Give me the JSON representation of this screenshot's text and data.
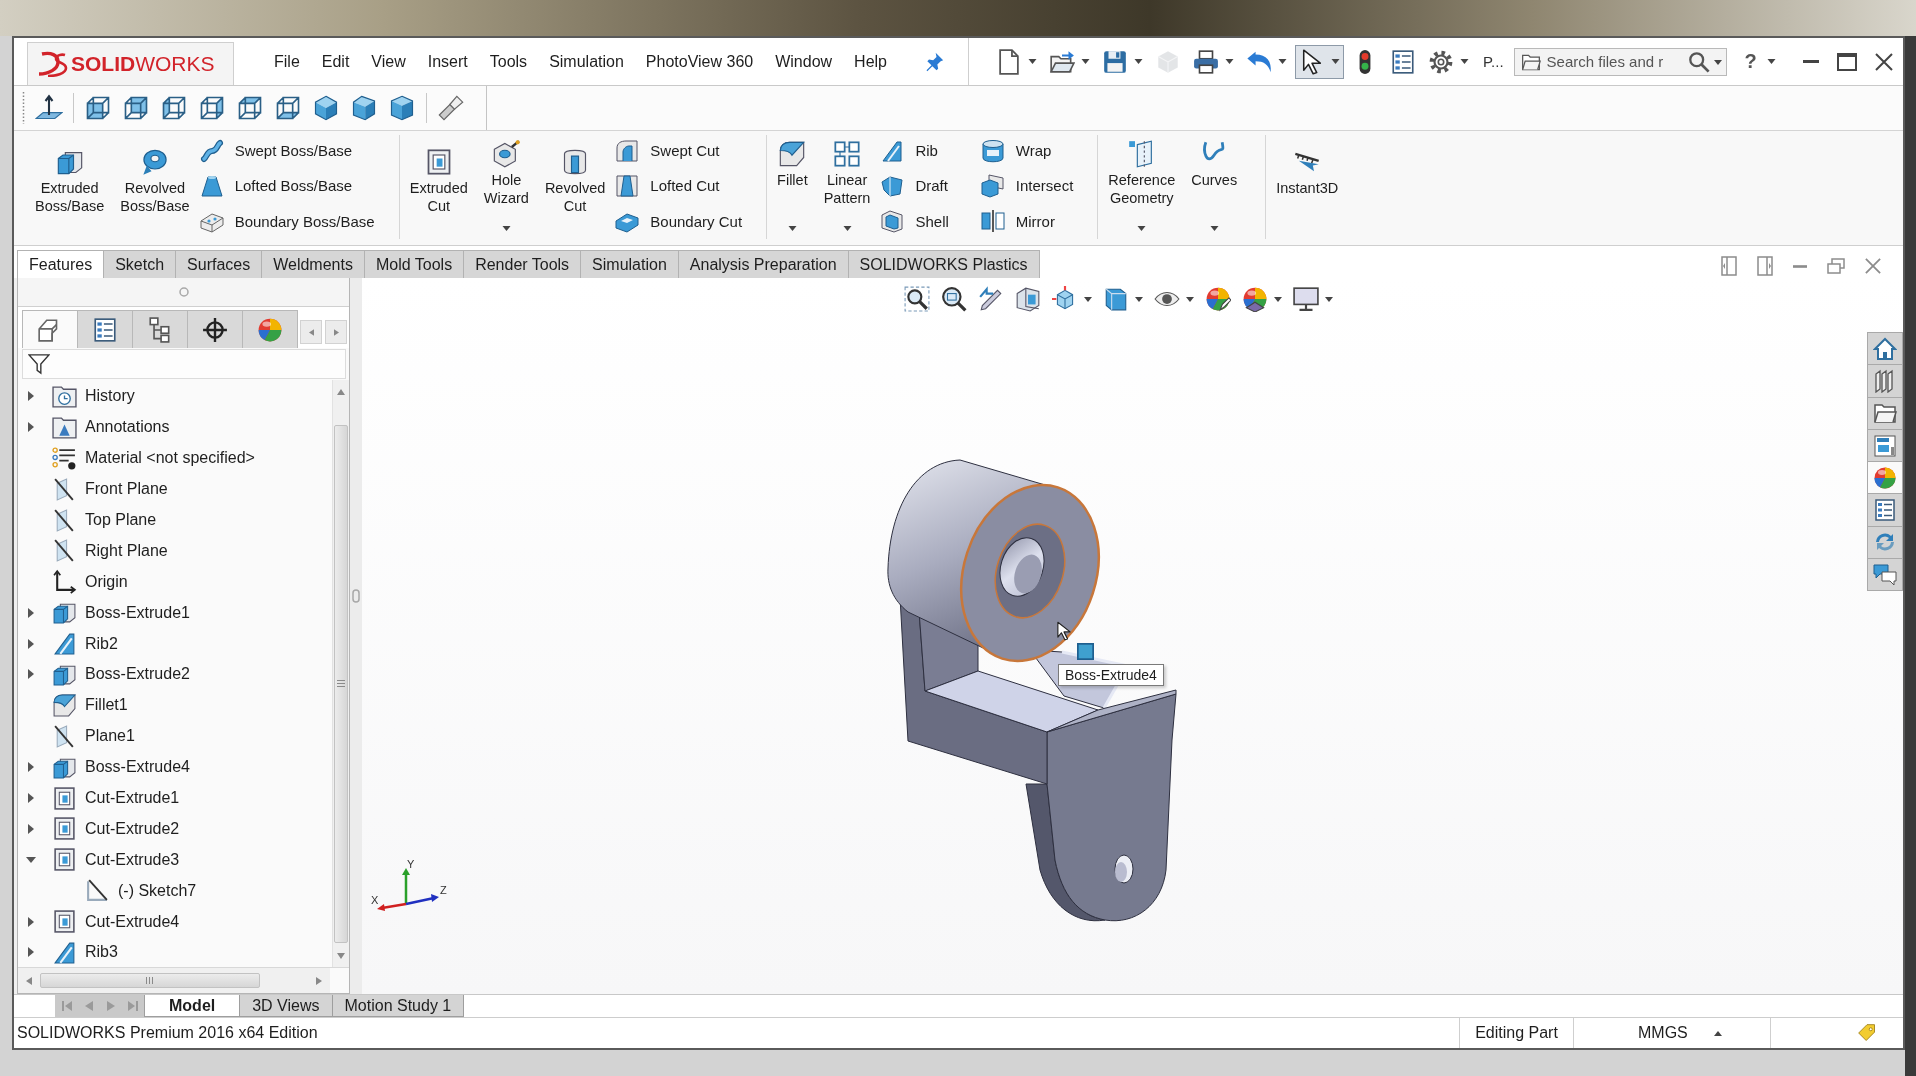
{
  "title_bar": {
    "logo": "**SOLID**WORKS",
    "menu": [
      "File",
      "Edit",
      "View",
      "Insert",
      "Tools",
      "Simulation",
      "PhotoView 360",
      "Window",
      "Help"
    ],
    "quick_access": [
      {
        "kind": "new",
        "dropdown": true,
        "pressed": false,
        "disabled": false
      },
      {
        "kind": "open",
        "dropdown": true,
        "pressed": false,
        "disabled": false
      },
      {
        "kind": "save",
        "dropdown": true,
        "pressed": false,
        "disabled": false
      },
      {
        "kind": "rebuild",
        "dropdown": false,
        "pressed": false,
        "disabled": true
      },
      {
        "kind": "print",
        "dropdown": true,
        "pressed": false,
        "disabled": false
      },
      {
        "kind": "undo",
        "dropdown": true,
        "pressed": false,
        "disabled": false
      },
      {
        "kind": "select",
        "dropdown": true,
        "pressed": true,
        "disabled": false
      },
      {
        "kind": "status",
        "dropdown": false,
        "pressed": false,
        "disabled": false
      },
      {
        "kind": "properties",
        "dropdown": false,
        "pressed": false,
        "disabled": false
      },
      {
        "kind": "options",
        "dropdown": true,
        "pressed": false,
        "disabled": false
      }
    ],
    "overflow": "P...",
    "search": {
      "placeholder": "Search files and r"
    },
    "help": "?"
  },
  "command_manager": {
    "groups": [
      {
        "buttons": [
          {
            "label": "Extruded Boss/Base",
            "dropdown": false
          },
          {
            "label": "Revolved Boss/Base",
            "dropdown": false
          }
        ],
        "columns": [
          [
            "Swept Boss/Base",
            "Lofted Boss/Base",
            "Boundary Boss/Base"
          ]
        ]
      },
      {
        "buttons": [
          {
            "label": "Extruded Cut",
            "dropdown": false
          },
          {
            "label": "Hole Wizard",
            "dropdown": true
          },
          {
            "label": "Revolved Cut",
            "dropdown": false
          }
        ],
        "columns": [
          [
            "Swept Cut",
            "Lofted Cut",
            "Boundary Cut"
          ]
        ]
      },
      {
        "buttons": [
          {
            "label": "Fillet",
            "dropdown": true
          },
          {
            "label": "Linear Pattern",
            "dropdown": true
          }
        ],
        "columns": [
          [
            "Rib",
            "Draft",
            "Shell"
          ],
          [
            "Wrap",
            "Intersect",
            "Mirror"
          ]
        ]
      },
      {
        "buttons": [
          {
            "label": "Reference Geometry",
            "dropdown": true
          },
          {
            "label": "Curves",
            "dropdown": true
          }
        ]
      },
      {
        "buttons": [
          {
            "label": "Instant3D",
            "dropdown": false
          }
        ]
      }
    ],
    "tabs": [
      {
        "label": "Features",
        "selected": true
      },
      {
        "label": "Sketch",
        "selected": false
      },
      {
        "label": "Surfaces",
        "selected": false
      },
      {
        "label": "Weldments",
        "selected": false
      },
      {
        "label": "Mold Tools",
        "selected": false
      },
      {
        "label": "Render Tools",
        "selected": false
      },
      {
        "label": "Simulation",
        "selected": false
      },
      {
        "label": "Analysis Preparation",
        "selected": false
      },
      {
        "label": "SOLIDWORKS Plastics",
        "selected": false
      }
    ]
  },
  "feature_manager": {
    "tabs": [
      {
        "kind": "features",
        "selected": true
      },
      {
        "kind": "properties",
        "selected": false
      },
      {
        "kind": "configurations",
        "selected": false
      },
      {
        "kind": "dimxpert",
        "selected": false
      },
      {
        "kind": "display",
        "selected": false
      }
    ],
    "tree": [
      {
        "label": "History",
        "kind": "history",
        "expandable": true,
        "expanded": false
      },
      {
        "label": "Annotations",
        "kind": "annotations",
        "expandable": true,
        "expanded": false
      },
      {
        "label": "Material <not specified>",
        "kind": "material",
        "expandable": false,
        "expanded": false
      },
      {
        "label": "Front Plane",
        "kind": "plane",
        "expandable": false,
        "expanded": false
      },
      {
        "label": "Top Plane",
        "kind": "plane",
        "expandable": false,
        "expanded": false
      },
      {
        "label": "Right Plane",
        "kind": "plane",
        "expandable": false,
        "expanded": false
      },
      {
        "label": "Origin",
        "kind": "origin",
        "expandable": false,
        "expanded": false
      },
      {
        "label": "Boss-Extrude1",
        "kind": "boss",
        "expandable": true,
        "expanded": false
      },
      {
        "label": "Rib2",
        "kind": "rib",
        "expandable": true,
        "expanded": false
      },
      {
        "label": "Boss-Extrude2",
        "kind": "boss",
        "expandable": true,
        "expanded": false
      },
      {
        "label": "Fillet1",
        "kind": "fillet",
        "expandable": false,
        "expanded": false
      },
      {
        "label": "Plane1",
        "kind": "plane",
        "expandable": false,
        "expanded": false
      },
      {
        "label": "Boss-Extrude4",
        "kind": "boss",
        "expandable": true,
        "expanded": false
      },
      {
        "label": "Cut-Extrude1",
        "kind": "cut",
        "expandable": true,
        "expanded": false
      },
      {
        "label": "Cut-Extrude2",
        "kind": "cut",
        "expandable": true,
        "expanded": false
      },
      {
        "label": "Cut-Extrude3",
        "kind": "cut",
        "expandable": true,
        "expanded": true,
        "children": [
          {
            "label": "(-) Sketch7",
            "kind": "sketch",
            "expandable": false,
            "expanded": false
          }
        ]
      },
      {
        "label": "Cut-Extrude4",
        "kind": "cut",
        "expandable": true,
        "expanded": false
      },
      {
        "label": "Rib3",
        "kind": "rib",
        "expandable": true,
        "expanded": false
      }
    ]
  },
  "viewport": {
    "tooltip": "Boss-Extrude4",
    "triad": {
      "x": "X",
      "y": "Y",
      "z": "Z"
    }
  },
  "task_pane": [
    {
      "kind": "home",
      "selected": false
    },
    {
      "kind": "library",
      "selected": false
    },
    {
      "kind": "files",
      "selected": false
    },
    {
      "kind": "palette",
      "selected": false
    },
    {
      "kind": "appearances",
      "selected": true
    },
    {
      "kind": "properties",
      "selected": false
    },
    {
      "kind": "sync",
      "selected": false
    },
    {
      "kind": "forum",
      "selected": false
    }
  ],
  "model_tabs": [
    {
      "label": "Model",
      "selected": true
    },
    {
      "label": "3D Views",
      "selected": false
    },
    {
      "label": "Motion Study 1",
      "selected": false
    }
  ],
  "status_bar": {
    "edition": "SOLIDWORKS Premium 2016 x64 Edition",
    "mode": "Editing Part",
    "units": "MMGS"
  }
}
